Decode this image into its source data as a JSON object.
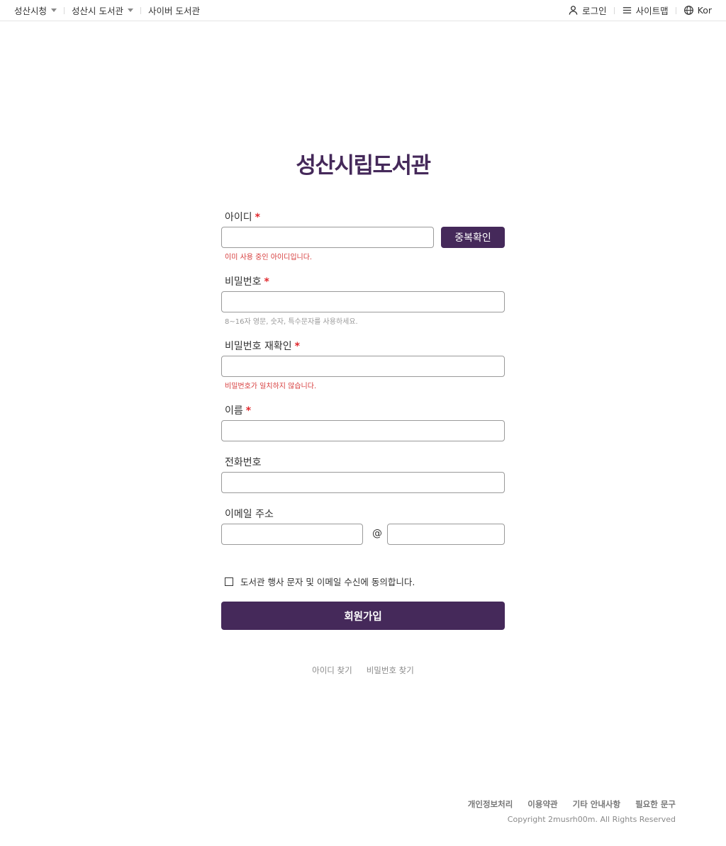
{
  "topbar": {
    "left": [
      {
        "label": "성산시청",
        "dropdown": true
      },
      {
        "label": "성산시 도서관",
        "dropdown": true
      },
      {
        "label": "사이버 도서관",
        "dropdown": false
      }
    ],
    "login": "로그인",
    "sitemap": "사이트맵",
    "language": "Kor"
  },
  "title": "성산시립도서관",
  "form": {
    "id_label": "아이디",
    "id_value": "",
    "dup_button": "중복확인",
    "id_error": "이미 사용 중인 아이디입니다.",
    "password_label": "비밀번호",
    "password_hint": "8~16자 영문, 숫자, 특수문자를 사용하세요.",
    "password_confirm_label": "비밀번호 재확인",
    "password_confirm_error": "비밀번호가 일치하지 않습니다.",
    "name_label": "이름",
    "phone_label": "전화번호",
    "email_label": "이메일 주소",
    "email_at": "@",
    "required_mark": "*",
    "agree_label": "도서관 행사 문자 및 이메일 수신에 동의합니다.",
    "agree_checked": false,
    "submit": "회원가입"
  },
  "find": {
    "find_id": "아이디 찾기",
    "find_password": "비밀번호 찾기"
  },
  "footer": {
    "links": [
      "개인정보처리",
      "이용약관",
      "기타 안내사항",
      "필요한 문구"
    ],
    "copyright": "Copyright 2musrh00m. All Rights Reserved"
  },
  "colors": {
    "brand": "#45295a",
    "error": "#d63a3a",
    "required": "#e0282d"
  }
}
